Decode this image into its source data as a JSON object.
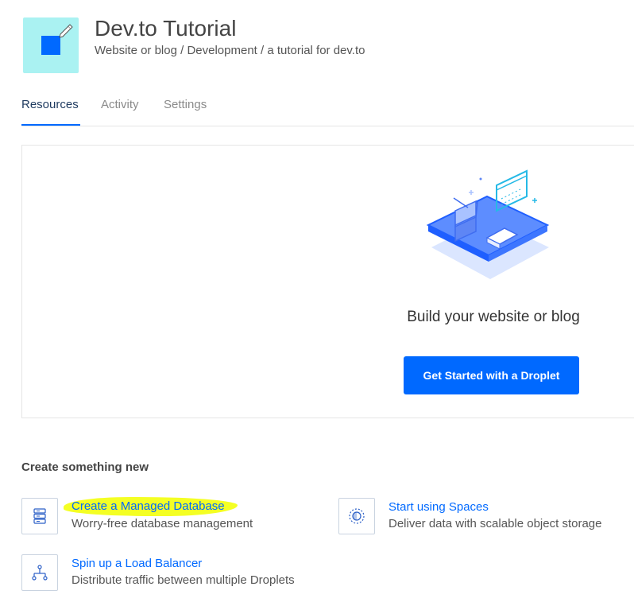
{
  "project": {
    "title": "Dev.to Tutorial",
    "breadcrumb": "Website or blog / Development / a tutorial for dev.to",
    "icon": "project-square-icon",
    "icon_bg": "#aaf2f2"
  },
  "tabs": [
    {
      "label": "Resources",
      "active": true
    },
    {
      "label": "Activity",
      "active": false
    },
    {
      "label": "Settings",
      "active": false
    }
  ],
  "hero": {
    "heading": "Build your website or blog",
    "button_label": "Get Started with a Droplet",
    "illustration": "isometric-platform-illustration"
  },
  "create_section": {
    "title": "Create something new",
    "items": [
      {
        "title": "Create a Managed Database",
        "description": "Worry-free database management",
        "icon": "database-icon",
        "highlighted": true
      },
      {
        "title": "Start using Spaces",
        "description": "Deliver data with scalable object storage",
        "icon": "spaces-icon",
        "highlighted": false
      },
      {
        "title": "Spin up a Load Balancer",
        "description": "Distribute traffic between multiple Droplets",
        "icon": "load-balancer-icon",
        "highlighted": false
      }
    ]
  },
  "colors": {
    "accent": "#0069ff",
    "highlight": "#f4ff24",
    "tab_active": "#1e3a5f",
    "tab_inactive": "#8a8a8a"
  }
}
